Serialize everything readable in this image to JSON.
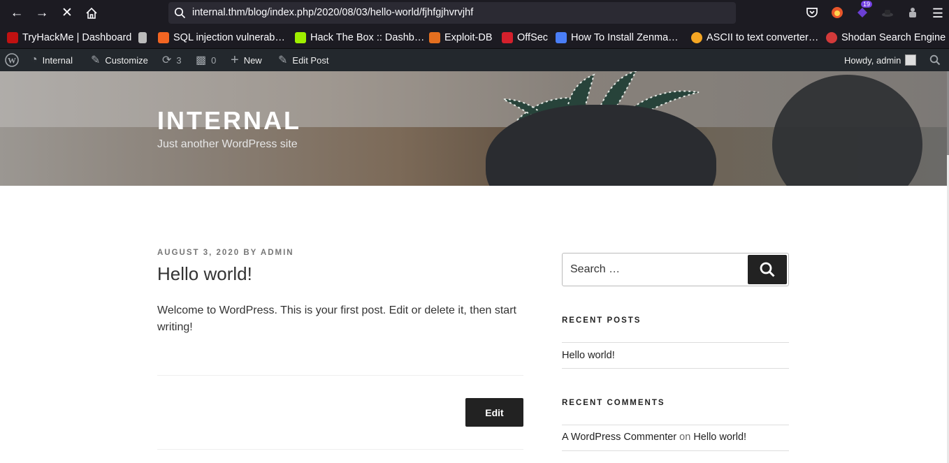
{
  "browser": {
    "url": "internal.thm/blog/index.php/2020/08/03/hello-world/fjhfgjhvrvjhf",
    "extension_badge": "19",
    "bookmarks": [
      {
        "label": "TryHackMe | Dashboard",
        "color": "#c11111"
      },
      {
        "label": "SQL injection vulnerab…",
        "color": "#f26522"
      },
      {
        "label": "Hack The Box :: Dashb…",
        "color": "#9fef00"
      },
      {
        "label": "Exploit-DB",
        "color": "#e46f1f"
      },
      {
        "label": "OffSec",
        "color": "#d4202c"
      },
      {
        "label": "How To Install Zenma…",
        "color": "#4a7ef7"
      },
      {
        "label": "ASCII to text converter…",
        "color": "#f5a623"
      },
      {
        "label": "Shodan Search Engine",
        "color": "#d33a3a"
      }
    ]
  },
  "adminbar": {
    "site": "Internal",
    "customize": "Customize",
    "updates": "3",
    "comments": "0",
    "new": "New",
    "edit_post": "Edit Post",
    "howdy": "Howdy, admin"
  },
  "header": {
    "title": "INTERNAL",
    "description": "Just another WordPress site"
  },
  "post": {
    "date": "AUGUST 3, 2020",
    "by": "BY",
    "author": "ADMIN",
    "title": "Hello world!",
    "body": "Welcome to WordPress. This is your first post. Edit or delete it, then start writing!",
    "edit_label": "Edit"
  },
  "sidebar": {
    "search_placeholder": "Search …",
    "recent_posts_title": "RECENT POSTS",
    "recent_posts": [
      "Hello world!"
    ],
    "recent_comments_title": "RECENT COMMENTS",
    "comment_author": "A WordPress Commenter",
    "comment_on": "on",
    "comment_post": "Hello world!"
  }
}
